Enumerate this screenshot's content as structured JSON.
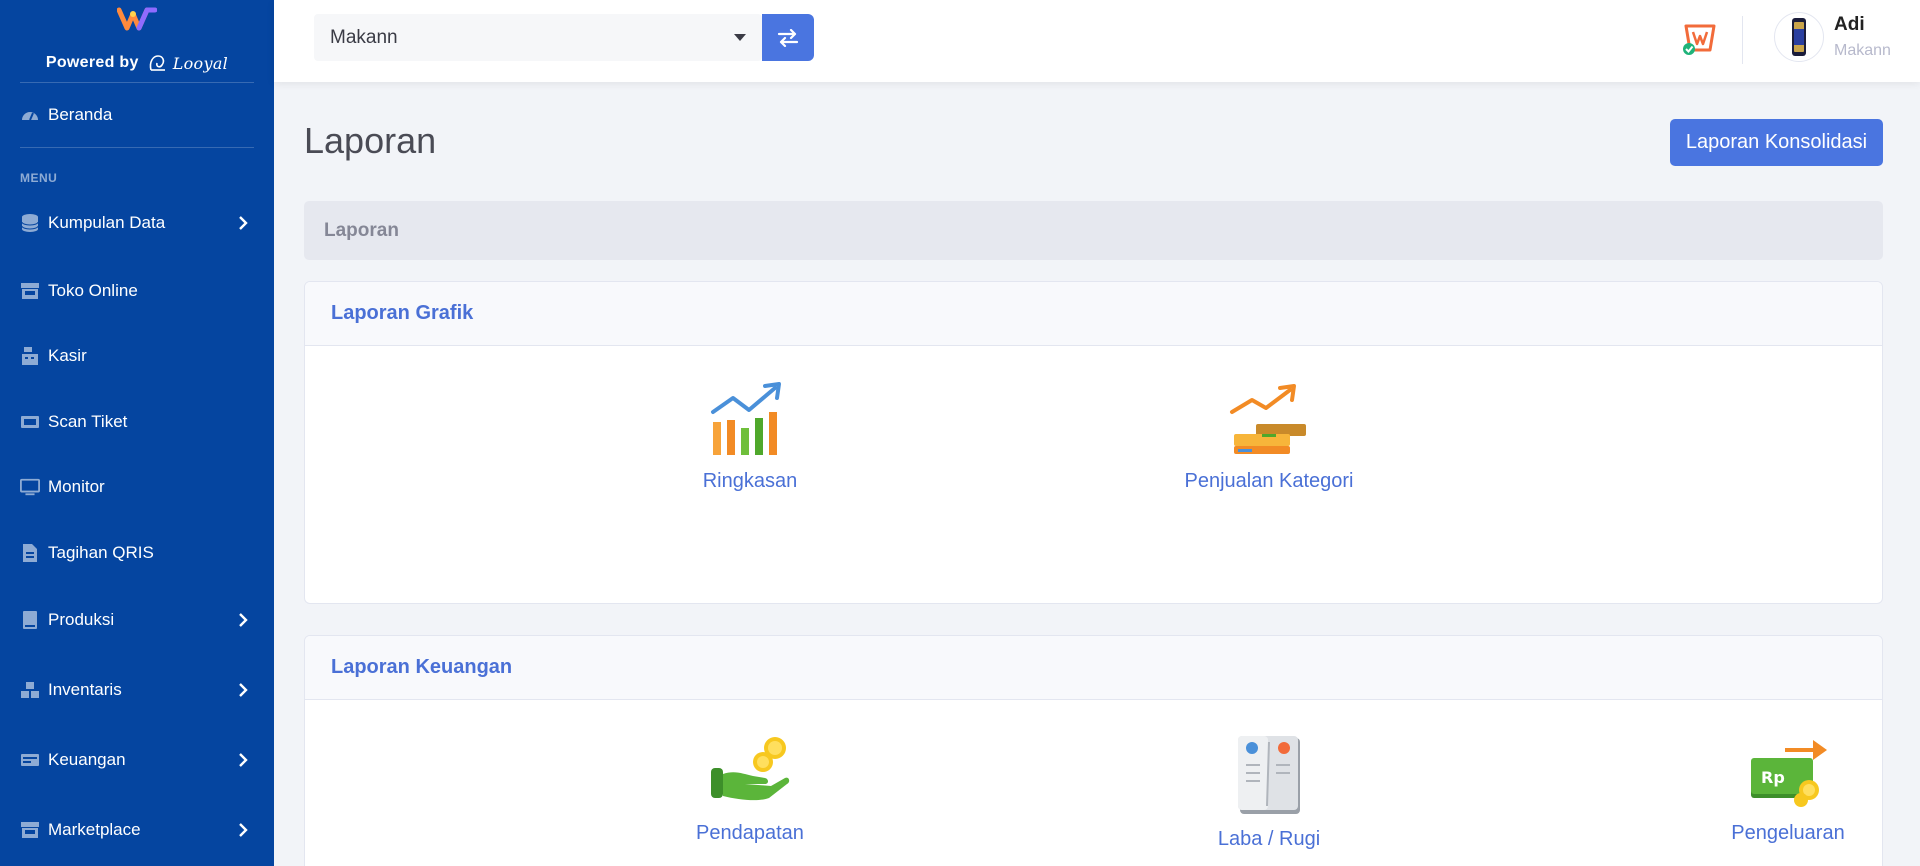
{
  "sidebar": {
    "powered_by": "Powered by",
    "brand_name": "Looyal",
    "beranda": "Beranda",
    "menu_heading": "MENU",
    "items": [
      {
        "label": "Kumpulan Data",
        "icon": "database-icon",
        "has_children": true
      },
      {
        "label": "Toko Online",
        "icon": "store-icon",
        "has_children": false
      },
      {
        "label": "Kasir",
        "icon": "cash-register-icon",
        "has_children": false
      },
      {
        "label": "Scan Tiket",
        "icon": "ticket-icon",
        "has_children": false
      },
      {
        "label": "Monitor",
        "icon": "monitor-icon",
        "has_children": false
      },
      {
        "label": "Tagihan QRIS",
        "icon": "invoice-icon",
        "has_children": false
      },
      {
        "label": "Produksi",
        "icon": "book-icon",
        "has_children": true
      },
      {
        "label": "Inventaris",
        "icon": "boxes-icon",
        "has_children": true
      },
      {
        "label": "Keuangan",
        "icon": "money-icon",
        "has_children": true
      },
      {
        "label": "Marketplace",
        "icon": "store-icon",
        "has_children": true
      }
    ]
  },
  "topbar": {
    "selected_store": "Makann",
    "user_name": "Adi",
    "user_store": "Makann"
  },
  "page": {
    "title": "Laporan",
    "konsolidasi_button": "Laporan Konsolidasi",
    "breadcrumb": "Laporan"
  },
  "sections": {
    "grafik": {
      "title": "Laporan Grafik",
      "tiles": [
        "Ringkasan",
        "Penjualan Kategori"
      ]
    },
    "keuangan": {
      "title": "Laporan Keuangan",
      "tiles": [
        "Pendapatan",
        "Laba / Rugi",
        "Pengeluaran"
      ],
      "currency_badge": "Rp"
    }
  },
  "colors": {
    "sidebar_bg": "#0545a0",
    "accent": "#4a75e0",
    "link": "#4a70d6"
  }
}
